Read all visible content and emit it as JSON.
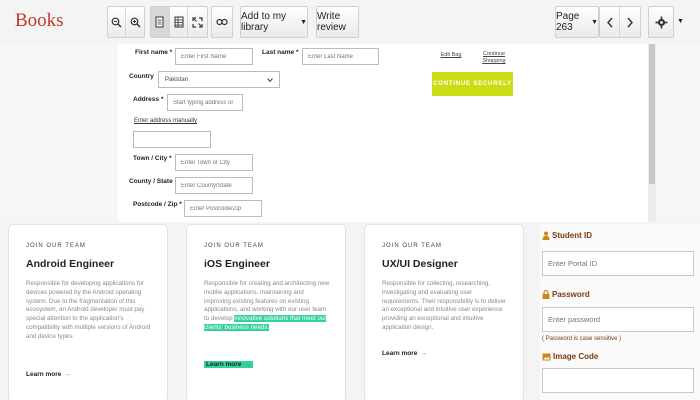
{
  "toolbar": {
    "logo": "Books",
    "add_to_library": "Add to my library",
    "write_review": "Write review",
    "page_label": "Page 263"
  },
  "form": {
    "first_name_label": "First name *",
    "first_name_placeholder": "Enter First Name",
    "last_name_label": "Last name *",
    "last_name_placeholder": "Enter Last Name",
    "country_label": "Country",
    "country_value": "Pakistan",
    "address_label": "Address *",
    "address_placeholder": "Start typing address or",
    "manual_link": "Enter address manually",
    "town_label": "Town / City *",
    "town_placeholder": "Enter Town or City",
    "county_label": "County / State",
    "county_placeholder": "Enter County/State",
    "postcode_label": "Postcode / Zip *",
    "postcode_placeholder": "Enter Postcode/Zip",
    "edit_bag": "Edit Bag",
    "continue_shopping": "Continue Shopping",
    "continue_securely": "CONTINUE SECURELY"
  },
  "jobs": [
    {
      "kicker": "JOIN OUR TEAM",
      "title": "Android Engineer",
      "desc": "Responsible for developing applications for devices powered by the Android operating system. Due to the fragmentation of this ecosystem, an Android developer must pay special attention to the application's compatibility with multiple versions of Android and device types.",
      "learn": "Learn more"
    },
    {
      "kicker": "JOIN OUR TEAM",
      "title": "iOS Engineer",
      "desc_pre": "Responsible for creating and architecting new mobile applications, maintaining and improving existing features on existing applications, and working with our user team to develop ",
      "desc_hl": "innovative solutions that meet our clients' business needs.",
      "learn": "Learn more"
    },
    {
      "kicker": "JOIN OUR TEAM",
      "title": "UX/UI Designer",
      "desc": "Responsible for collecting, researching, investigating and evaluating user requirements. Their responsibility is to deliver an exceptional and intuitive user experience providing an exceptional and intuitive application design.",
      "learn": "Learn more"
    }
  ],
  "login": {
    "student_id_label": "Student ID",
    "student_id_placeholder": "Enter Portal ID",
    "password_label": "Password",
    "password_placeholder": "Enter password",
    "password_note": "( Password is case sensitive )",
    "image_code_label": "Image Code"
  },
  "colors": {
    "logo": "#c0392b",
    "continue_button": "#cbdc15",
    "highlight": "#35d19a",
    "login_label": "#7a3a10",
    "learn_arrow": "#1aa34a"
  },
  "icons": [
    "zoom-out-icon",
    "zoom-in-icon",
    "single-page-icon",
    "page-list-icon",
    "fullscreen-icon",
    "link-icon",
    "chevron-left-icon",
    "chevron-right-icon",
    "gear-icon",
    "user-icon",
    "lock-icon",
    "image-icon"
  ]
}
